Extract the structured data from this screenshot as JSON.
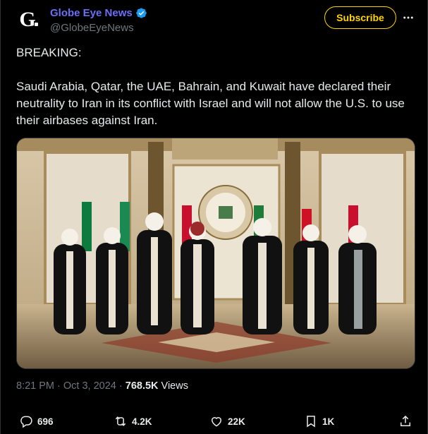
{
  "author": {
    "name": "Globe Eye News",
    "handle": "@GlobeEyeNews",
    "avatar_letter": "G",
    "verified": true
  },
  "header": {
    "subscribe_label": "Subscribe",
    "more_icon": "more-dots-icon"
  },
  "tweet": {
    "line1": "BREAKING:",
    "body": "Saudi Arabia, Qatar, the UAE, Bahrain, and Kuwait have declared their neutrality to Iran in its conflict with Israel and will not allow the U.S. to use their airbases against Iran."
  },
  "meta": {
    "time": "8:21 PM",
    "separator": " · ",
    "date": "Oct 3, 2024",
    "views_count": "768.5K",
    "views_label": "Views"
  },
  "actions": {
    "replies": "696",
    "reposts": "4.2K",
    "likes": "22K",
    "bookmarks": "1K"
  },
  "colors": {
    "background": "#000000",
    "name": "#6b6ef6",
    "subscribe": "#ffd400",
    "muted": "#71767b",
    "text": "#e7e9ea",
    "verified": "#1d9bf0"
  }
}
